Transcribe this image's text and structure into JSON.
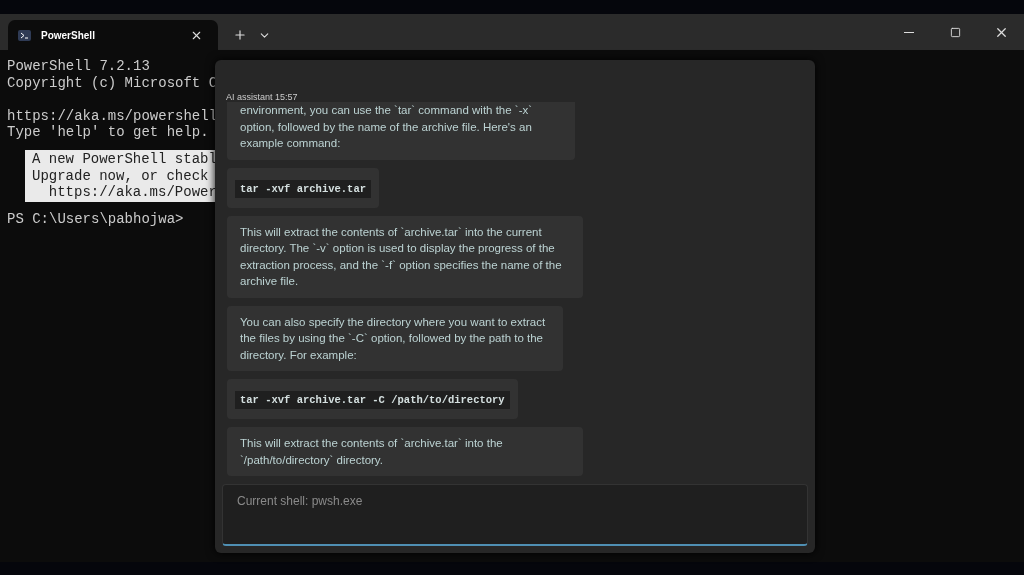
{
  "tabs": [
    {
      "title": "PowerShell",
      "selected": true
    }
  ],
  "terminal": {
    "blocks": [
      [
        "PowerShell 7.2.13",
        "Copyright (c) Microsoft C"
      ],
      [
        "https://aka.ms/powershell",
        "Type 'help' to get help."
      ]
    ],
    "notice": [
      "A new PowerShell stabl",
      "Upgrade now, or check",
      "  https://aka.ms/Power"
    ],
    "prompt": "PS C:\\Users\\pabhojwa>"
  },
  "assistant": {
    "header": "AI assistant 15:57",
    "messages": [
      {
        "kind": "text",
        "text": "environment, you can use the `tar` command with the `-x` option, followed by the name of the archive file. Here's an example command:"
      },
      {
        "kind": "code",
        "text": "tar -xvf archive.tar"
      },
      {
        "kind": "text",
        "text": "This will extract the contents of `archive.tar` into the current directory. The `-v` option is used to display the progress of the extraction process, and the `-f` option specifies the name of the archive file."
      },
      {
        "kind": "text",
        "text": "You can also specify the directory where you want to extract the files by using the `-C` option, followed by the path to the directory. For example:"
      },
      {
        "kind": "code",
        "text": "tar -xvf archive.tar -C /path/to/directory"
      },
      {
        "kind": "text",
        "text": "This will extract the contents of `archive.tar` into the `/path/to/directory` directory."
      }
    ],
    "input": {
      "placeholder": "Current shell: pwsh.exe"
    }
  }
}
